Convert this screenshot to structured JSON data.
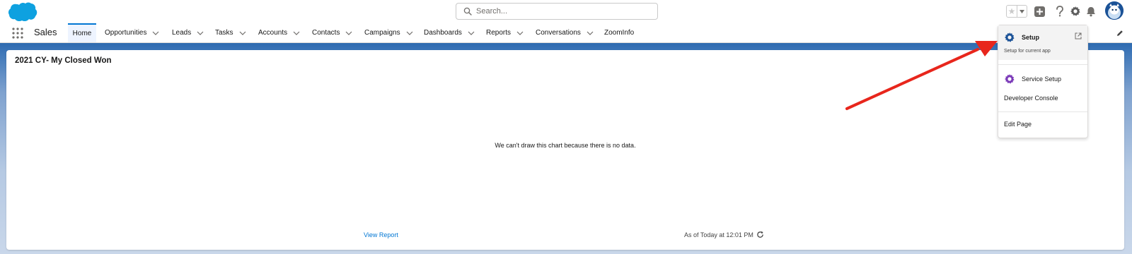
{
  "header": {
    "search_placeholder": "Search..."
  },
  "nav": {
    "app_name": "Sales",
    "items": [
      {
        "label": "Home",
        "active": true,
        "chevron": false
      },
      {
        "label": "Opportunities",
        "active": false,
        "chevron": true
      },
      {
        "label": "Leads",
        "active": false,
        "chevron": true
      },
      {
        "label": "Tasks",
        "active": false,
        "chevron": true
      },
      {
        "label": "Accounts",
        "active": false,
        "chevron": true
      },
      {
        "label": "Contacts",
        "active": false,
        "chevron": true
      },
      {
        "label": "Campaigns",
        "active": false,
        "chevron": true
      },
      {
        "label": "Dashboards",
        "active": false,
        "chevron": true
      },
      {
        "label": "Reports",
        "active": false,
        "chevron": true
      },
      {
        "label": "Conversations",
        "active": false,
        "chevron": true
      },
      {
        "label": "ZoomInfo",
        "active": false,
        "chevron": false
      }
    ]
  },
  "card": {
    "title": "2021 CY- My Closed Won",
    "message": "We can't draw this chart because there is no data.",
    "view_report": "View Report",
    "as_of": "As of Today at 12:01 PM"
  },
  "setup_menu": {
    "setup_label": "Setup",
    "setup_sub": "Setup for current app",
    "service_setup_label": "Service Setup",
    "developer_console_label": "Developer Console",
    "edit_page_label": "Edit Page"
  },
  "colors": {
    "brand_blue": "#0176d3",
    "band_blue": "#2e6bb0",
    "setup_gear": "#1b5297",
    "service_gear": "#7b3ab8",
    "arrow_red": "#e8261c"
  },
  "icons": [
    "salesforce-cloud-logo",
    "search-icon",
    "star-icon",
    "caret-down-icon",
    "add-icon",
    "help-icon",
    "gear-icon",
    "bell-icon",
    "avatar",
    "app-launcher-icon",
    "chevron-down-icon",
    "pencil-icon",
    "refresh-icon",
    "external-link-icon"
  ]
}
